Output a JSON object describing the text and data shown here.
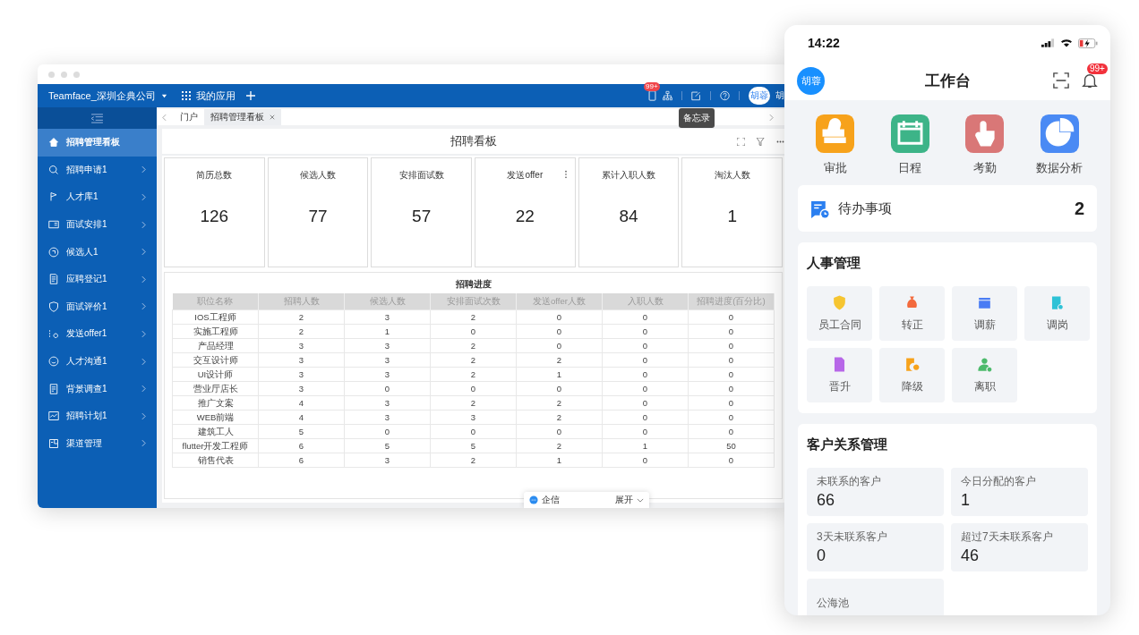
{
  "desktop": {
    "company": "Teamface_深圳企典公司",
    "apps_label": "我的应用",
    "notice_badge": "99+",
    "avatar": "胡蓉",
    "user_name": "胡",
    "tooltip": "备忘录",
    "sidebar": [
      {
        "label": "招聘管理看板",
        "selected": true
      },
      {
        "label": "招聘申请1",
        "selected": false
      },
      {
        "label": "人才库1",
        "selected": false
      },
      {
        "label": "面试安排1",
        "selected": false
      },
      {
        "label": "候选人1",
        "selected": false
      },
      {
        "label": "应聘登记1",
        "selected": false
      },
      {
        "label": "面试评价1",
        "selected": false
      },
      {
        "label": "发送offer1",
        "selected": false
      },
      {
        "label": "人才沟通1",
        "selected": false
      },
      {
        "label": "背景调查1",
        "selected": false
      },
      {
        "label": "招聘计划1",
        "selected": false
      },
      {
        "label": "渠道管理",
        "selected": false
      }
    ],
    "tabs": [
      {
        "label": "门户",
        "selected": false,
        "closable": false
      },
      {
        "label": "招聘管理看板",
        "selected": true,
        "closable": true
      }
    ],
    "board_title": "招聘看板",
    "stats": [
      {
        "label": "简历总数",
        "value": "126",
        "menu": false
      },
      {
        "label": "候选人数",
        "value": "77",
        "menu": false
      },
      {
        "label": "安排面试数",
        "value": "57",
        "menu": false
      },
      {
        "label": "发送offer",
        "value": "22",
        "menu": true
      },
      {
        "label": "累计入职人数",
        "value": "84",
        "menu": false
      },
      {
        "label": "淘汰人数",
        "value": "1",
        "menu": false
      }
    ],
    "table": {
      "title": "招聘进度",
      "columns": [
        "职位名称",
        "招聘人数",
        "候选人数",
        "安排面试次数",
        "发送offer人数",
        "入职人数",
        "招聘进度(百分比)"
      ],
      "rows": [
        [
          "IOS工程师",
          "2",
          "3",
          "2",
          "0",
          "0",
          "0"
        ],
        [
          "实施工程师",
          "2",
          "1",
          "0",
          "0",
          "0",
          "0"
        ],
        [
          "产品经理",
          "3",
          "3",
          "2",
          "0",
          "0",
          "0"
        ],
        [
          "交互设计师",
          "3",
          "3",
          "2",
          "2",
          "0",
          "0"
        ],
        [
          "UI设计师",
          "3",
          "3",
          "2",
          "1",
          "0",
          "0"
        ],
        [
          "营业厅店长",
          "3",
          "0",
          "0",
          "0",
          "0",
          "0"
        ],
        [
          "推广文案",
          "4",
          "3",
          "2",
          "2",
          "0",
          "0"
        ],
        [
          "WEB前端",
          "4",
          "3",
          "3",
          "2",
          "0",
          "0"
        ],
        [
          "建筑工人",
          "5",
          "0",
          "0",
          "0",
          "0",
          "0"
        ],
        [
          "flutter开发工程师",
          "6",
          "5",
          "5",
          "2",
          "1",
          "50"
        ],
        [
          "销售代表",
          "6",
          "3",
          "2",
          "1",
          "0",
          "0"
        ]
      ]
    },
    "chat": {
      "label": "企信",
      "expand": "展开"
    }
  },
  "phone": {
    "time": "14:22",
    "avatar": "胡蓉",
    "title": "工作台",
    "badge": "99+",
    "quick_apps": [
      {
        "label": "审批",
        "color": "#f7a21b"
      },
      {
        "label": "日程",
        "color": "#3db488"
      },
      {
        "label": "考勤",
        "color": "#d97777"
      },
      {
        "label": "数据分析",
        "color": "#4a8af4"
      }
    ],
    "todo": {
      "label": "待办事项",
      "count": "2"
    },
    "hr": {
      "title": "人事管理",
      "items": [
        {
          "label": "员工合同"
        },
        {
          "label": "转正"
        },
        {
          "label": "调薪"
        },
        {
          "label": "调岗"
        },
        {
          "label": "晋升"
        },
        {
          "label": "降级"
        },
        {
          "label": "离职"
        }
      ]
    },
    "crm": {
      "title": "客户关系管理",
      "items": [
        {
          "label": "未联系的客户",
          "value": "66"
        },
        {
          "label": "今日分配的客户",
          "value": "1"
        },
        {
          "label": "3天未联系客户",
          "value": "0"
        },
        {
          "label": "超过7天未联系客户",
          "value": "46"
        },
        {
          "label": "公海池"
        }
      ]
    }
  }
}
